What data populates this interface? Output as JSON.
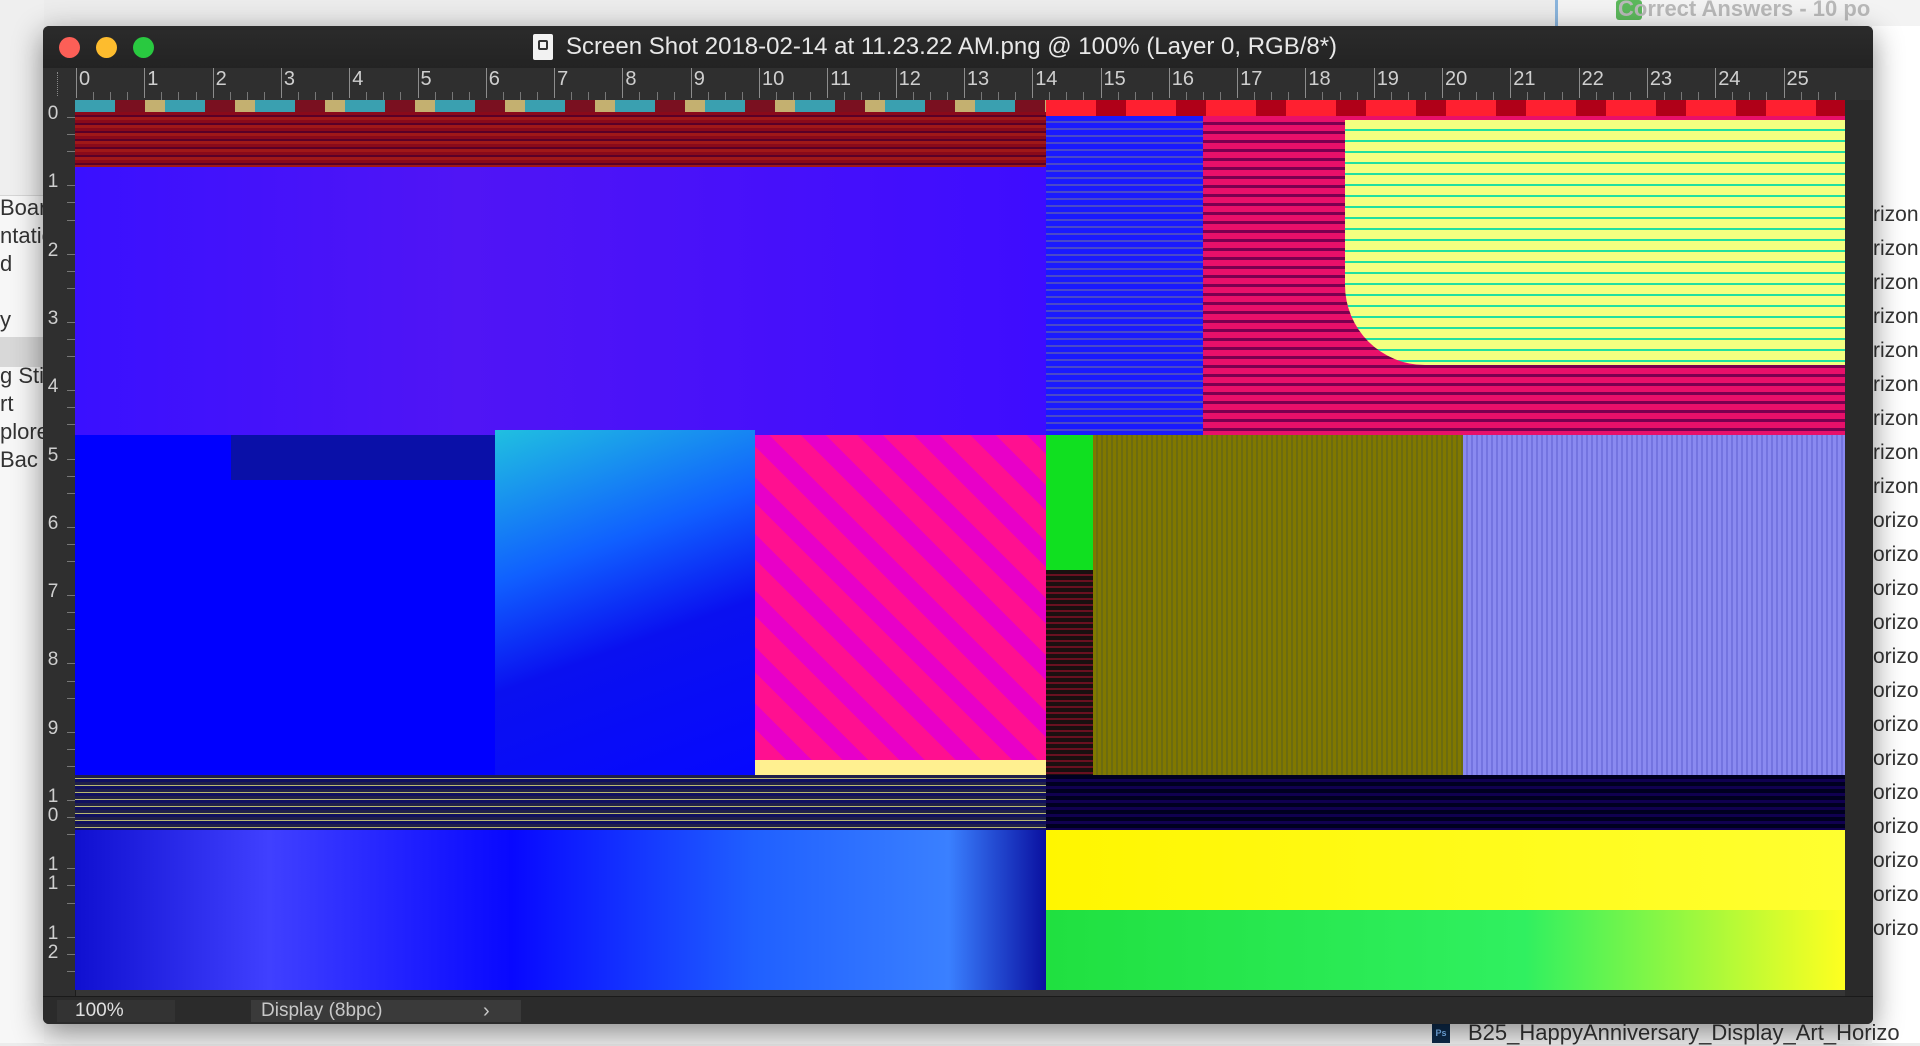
{
  "background_app": {
    "left_items": [
      "Boar",
      "ntatic",
      "d",
      "",
      "y",
      "g Stil",
      "rt",
      "plore",
      "Bac"
    ],
    "right_items": [
      "rizon",
      "rizon",
      "rizon",
      "rizon",
      "rizon",
      "rizon",
      "rizon",
      "rizon",
      "rizon",
      "orizo",
      "orizo",
      "orizo",
      "orizo",
      "orizo",
      "orizo",
      "orizo",
      "orizo",
      "orizo",
      "orizo",
      "orizo",
      "orizo",
      "orizo"
    ],
    "top_right": "Correct Answers - 10 po",
    "bottom_file": "B25_HappyAnniversary_Display_Art_Horizo",
    "file_badge": "Ps"
  },
  "window": {
    "title": "Screen Shot 2018-02-14 at 11.23.22 AM.png @ 100% (Layer 0, RGB/8*)",
    "ruler_h": [
      "0",
      "1",
      "2",
      "3",
      "4",
      "5",
      "6",
      "7",
      "8",
      "9",
      "10",
      "11",
      "12",
      "13",
      "14",
      "15",
      "16",
      "17",
      "18",
      "19",
      "20",
      "21",
      "22",
      "23",
      "24",
      "25"
    ],
    "ruler_v": [
      "0",
      "1",
      "2",
      "3",
      "4",
      "5",
      "6",
      "7",
      "8",
      "9",
      "1\n0",
      "1\n1",
      "1\n2"
    ]
  },
  "statusbar": {
    "zoom": "100%",
    "display": "Display (8bpc)",
    "arrow": "›"
  },
  "colors": {
    "window_bg": "#353535",
    "titlebar": "#262626",
    "close": "#fc5f57",
    "minimize": "#fdbc2e",
    "maximize": "#29c940"
  }
}
